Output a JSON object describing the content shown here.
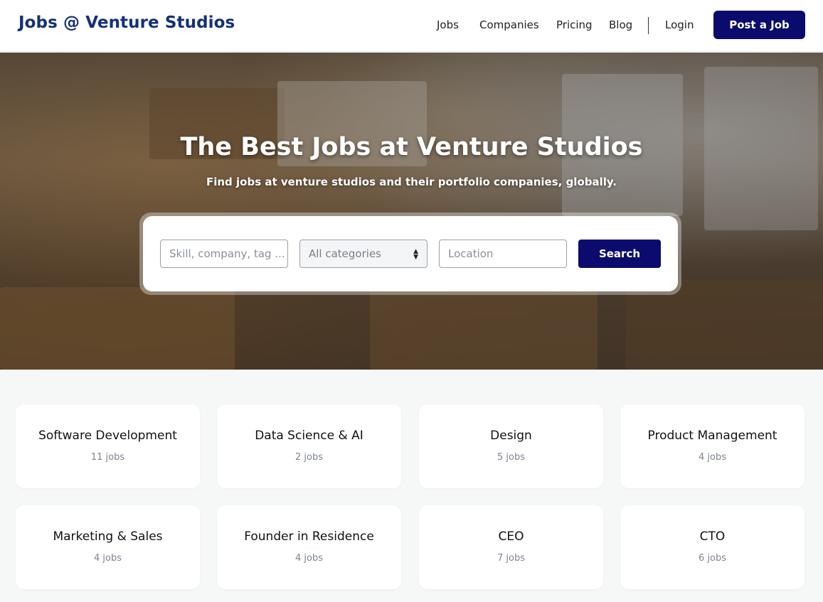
{
  "header": {
    "brand": "Jobs @ Venture Studios",
    "nav": [
      "Jobs",
      "Companies",
      "Pricing",
      "Blog"
    ],
    "login": "Login",
    "post_job": "Post a Job"
  },
  "hero": {
    "title": "The Best Jobs at Venture Studios",
    "subtitle": "Find jobs at venture studios and their portfolio companies, globally."
  },
  "search": {
    "keyword_placeholder": "Skill, company, tag ...",
    "category_selected": "All categories",
    "location_placeholder": "Location",
    "button": "Search"
  },
  "categories": [
    {
      "title": "Software Development",
      "count": "11 jobs"
    },
    {
      "title": "Data Science & AI",
      "count": "2 jobs"
    },
    {
      "title": "Design",
      "count": "5 jobs"
    },
    {
      "title": "Product Management",
      "count": "4 jobs"
    },
    {
      "title": "Marketing & Sales",
      "count": "4 jobs"
    },
    {
      "title": "Founder in Residence",
      "count": "4 jobs"
    },
    {
      "title": "CEO",
      "count": "7 jobs"
    },
    {
      "title": "CTO",
      "count": "6 jobs"
    }
  ],
  "colors": {
    "brand": "#14307a",
    "primary_button": "#0b0b6e",
    "page_background": "#f6f8f7"
  }
}
